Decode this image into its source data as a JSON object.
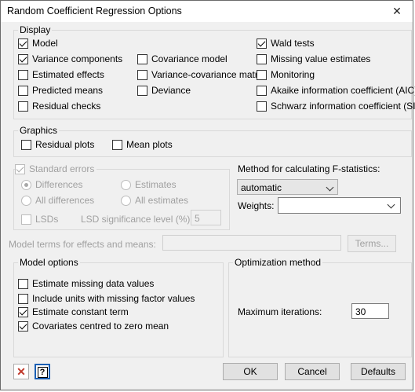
{
  "window": {
    "title": "Random Coefficient Regression Options",
    "close_glyph": "✕"
  },
  "display": {
    "label": "Display",
    "col1": [
      {
        "label": "Model",
        "checked": true
      },
      {
        "label": "Variance components",
        "checked": true
      },
      {
        "label": "Estimated effects",
        "checked": false
      },
      {
        "label": "Predicted means",
        "checked": false
      },
      {
        "label": "Residual checks",
        "checked": false
      }
    ],
    "col2": [
      {
        "label": "Covariance model",
        "checked": false
      },
      {
        "label": "Variance-covariance matrix",
        "checked": false
      },
      {
        "label": "Deviance",
        "checked": false
      }
    ],
    "col3": [
      {
        "label": "Wald tests",
        "checked": true
      },
      {
        "label": "Missing value estimates",
        "checked": false
      },
      {
        "label": "Monitoring",
        "checked": false
      },
      {
        "label": "Akaike information coefficient (AIC)",
        "checked": false
      },
      {
        "label": "Schwarz information coefficient (SIC)",
        "checked": false
      }
    ]
  },
  "graphics": {
    "label": "Graphics",
    "residual_plots": "Residual plots",
    "mean_plots": "Mean plots"
  },
  "standard_errors": {
    "label": "Standard errors",
    "differences": "Differences",
    "all_differences": "All differences",
    "estimates": "Estimates",
    "all_estimates": "All estimates",
    "lsds": "LSDs",
    "lsd_level_label": "LSD significance level (%):",
    "lsd_level_value": "5"
  },
  "fstat": {
    "label": "Method for calculating F-statistics:",
    "selected": "automatic",
    "weights_label": "Weights:",
    "weights_value": ""
  },
  "model_terms": {
    "label": "Model terms for effects and means:",
    "value": "",
    "terms_button": "Terms..."
  },
  "model_options": {
    "label": "Model options",
    "items": [
      {
        "label": "Estimate missing data values",
        "checked": false
      },
      {
        "label": "Include units with missing factor values",
        "checked": false
      },
      {
        "label": "Estimate constant term",
        "checked": true
      },
      {
        "label": "Covariates centred to zero mean",
        "checked": true
      }
    ]
  },
  "optimization": {
    "label": "Optimization method",
    "max_iter_label": "Maximum iterations:",
    "max_iter_value": "30"
  },
  "buttons": {
    "ok": "OK",
    "cancel": "Cancel",
    "defaults": "Defaults",
    "close_icon_glyph": "✕",
    "help_icon_glyph": "?"
  },
  "colors": {
    "close_icon": "#c0392b",
    "help_border": "#1a5fb4"
  }
}
